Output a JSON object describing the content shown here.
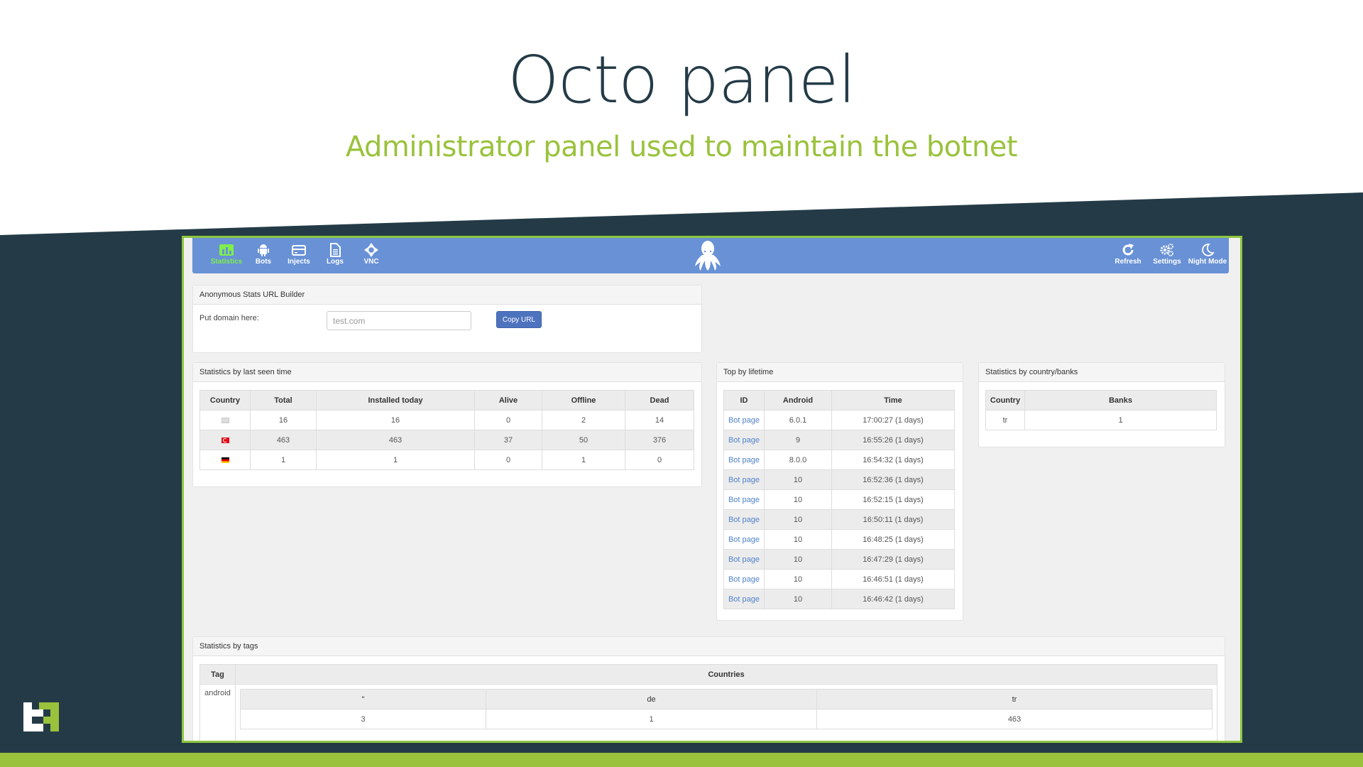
{
  "slide": {
    "title": "Octo panel",
    "subtitle": "Administrator panel used to maintain the botnet",
    "colors": {
      "dark": "#243b47",
      "accent": "#9ac23c"
    }
  },
  "navbar": {
    "left_items": [
      {
        "label": "Statistics",
        "icon": "bar-chart-icon",
        "active": true
      },
      {
        "label": "Bots",
        "icon": "android-icon",
        "active": false
      },
      {
        "label": "Injects",
        "icon": "credit-card-icon",
        "active": false
      },
      {
        "label": "Logs",
        "icon": "document-icon",
        "active": false
      },
      {
        "label": "VNC",
        "icon": "move-arrows-icon",
        "active": false
      }
    ],
    "logo_icon": "octopus-icon",
    "right_items": [
      {
        "label": "Refresh",
        "icon": "refresh-icon"
      },
      {
        "label": "Settings",
        "icon": "gears-icon"
      },
      {
        "label": "Night Mode",
        "icon": "moon-icon"
      }
    ],
    "colors": {
      "bar": "#6891d6",
      "active": "#7ef04a"
    }
  },
  "url_builder": {
    "title": "Anonymous Stats URL Builder",
    "label": "Put domain here:",
    "input_placeholder": "test.com",
    "input_value": "",
    "button_label": "Copy URL"
  },
  "last_seen": {
    "title": "Statistics by last seen time",
    "columns": [
      "Country",
      "Total",
      "Installed today",
      "Alive",
      "Offline",
      "Dead"
    ],
    "rows": [
      {
        "flag": "unknown",
        "total": "16",
        "installed_today": "16",
        "alive": "0",
        "offline": "2",
        "dead": "14"
      },
      {
        "flag": "tr",
        "total": "463",
        "installed_today": "463",
        "alive": "37",
        "offline": "50",
        "dead": "376"
      },
      {
        "flag": "de",
        "total": "1",
        "installed_today": "1",
        "alive": "0",
        "offline": "1",
        "dead": "0"
      }
    ]
  },
  "top_lifetime": {
    "title": "Top by lifetime",
    "columns": [
      "ID",
      "Android",
      "Time"
    ],
    "rows": [
      {
        "id": "Bot page",
        "android": "6.0.1",
        "time": "17:00:27 (1 days)"
      },
      {
        "id": "Bot page",
        "android": "9",
        "time": "16:55:26 (1 days)"
      },
      {
        "id": "Bot page",
        "android": "8.0.0",
        "time": "16:54:32 (1 days)"
      },
      {
        "id": "Bot page",
        "android": "10",
        "time": "16:52:36 (1 days)"
      },
      {
        "id": "Bot page",
        "android": "10",
        "time": "16:52:15 (1 days)"
      },
      {
        "id": "Bot page",
        "android": "10",
        "time": "16:50:11 (1 days)"
      },
      {
        "id": "Bot page",
        "android": "10",
        "time": "16:48:25 (1 days)"
      },
      {
        "id": "Bot page",
        "android": "10",
        "time": "16:47:29 (1 days)"
      },
      {
        "id": "Bot page",
        "android": "10",
        "time": "16:46:51 (1 days)"
      },
      {
        "id": "Bot page",
        "android": "10",
        "time": "16:46:42 (1 days)"
      }
    ]
  },
  "country_banks": {
    "title": "Statistics by country/banks",
    "columns": [
      "Country",
      "Banks"
    ],
    "rows": [
      {
        "country": "tr",
        "banks": "1"
      }
    ]
  },
  "tags": {
    "title": "Statistics by tags",
    "columns": [
      "Tag",
      "Countries"
    ],
    "rows": [
      {
        "tag": "android",
        "countries": [
          "\"",
          "de",
          "tr"
        ],
        "counts": [
          "3",
          "1",
          "463"
        ]
      }
    ]
  }
}
